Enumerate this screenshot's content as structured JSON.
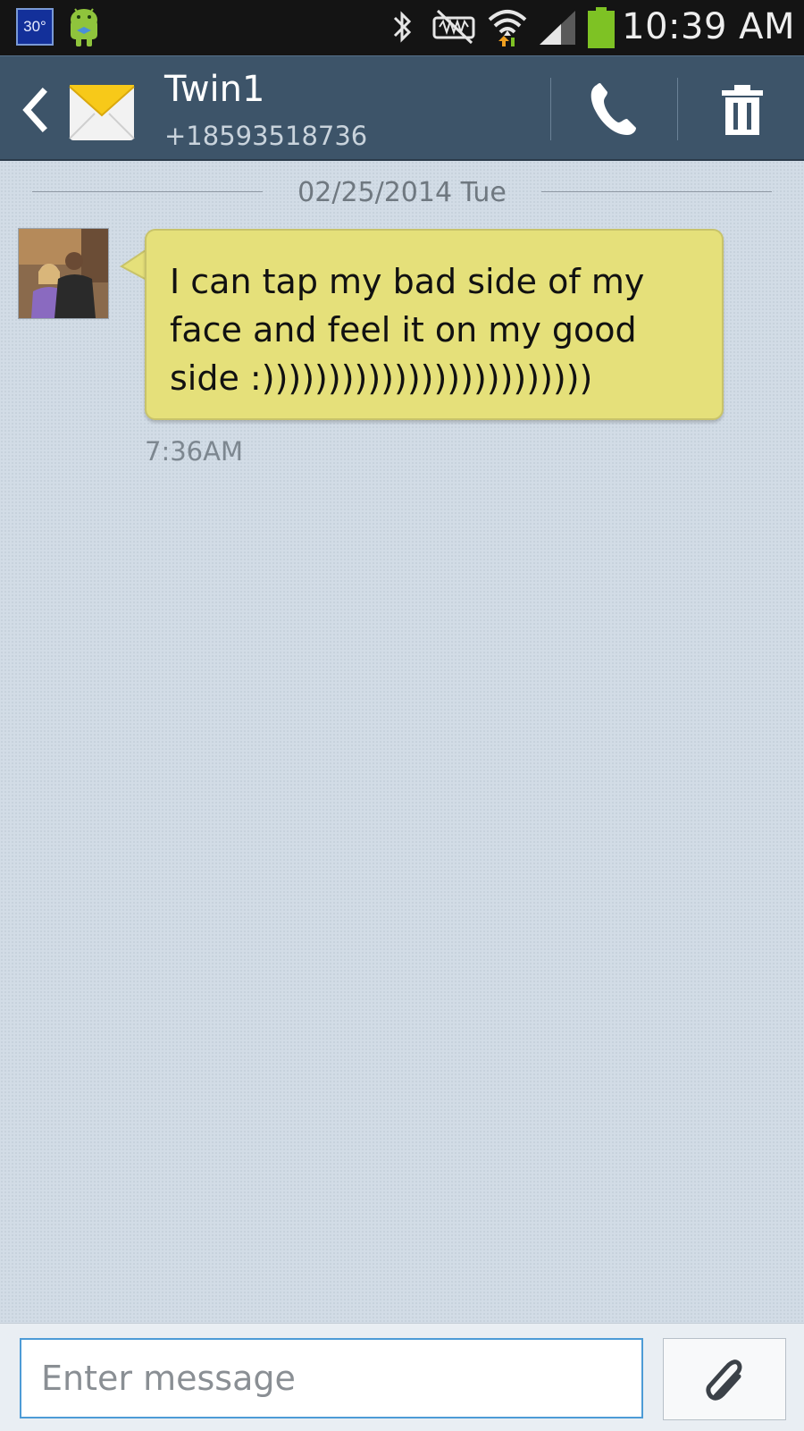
{
  "status_bar": {
    "weather_temp": "30°",
    "time": "10:39 AM",
    "icons": [
      "android-notification-icon",
      "bluetooth-icon",
      "silent-mode-icon",
      "wifi-icon",
      "signal-icon",
      "battery-icon"
    ]
  },
  "header": {
    "contact_name": "Twin1",
    "contact_number": "+18593518736",
    "icons": [
      "back-icon",
      "envelope-icon",
      "call-icon",
      "trash-icon"
    ]
  },
  "conversation": {
    "date_separator": "02/25/2014 Tue",
    "messages": [
      {
        "text": "I can tap my bad side of my face and feel it on my good side :)))))))))))))))))))))))))",
        "time": "7:36AM"
      }
    ]
  },
  "composer": {
    "placeholder": "Enter message",
    "value": ""
  },
  "colors": {
    "status_bar": "#141414",
    "header": "#3d5469",
    "conversation_bg": "#d2dce6",
    "bubble": "#e5e07a",
    "input_border": "#4d9bd6",
    "battery": "#7ec224"
  }
}
